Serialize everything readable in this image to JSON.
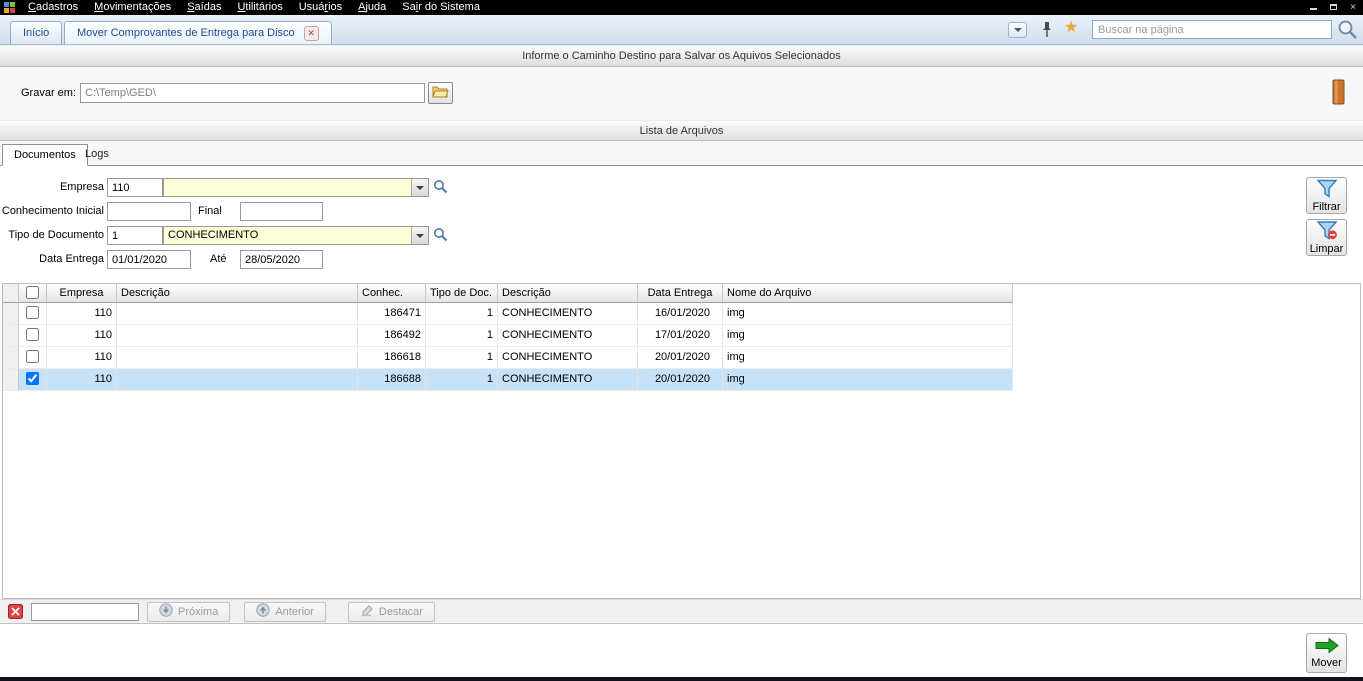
{
  "menu": {
    "items": [
      {
        "label": "Cadastros",
        "u": 0
      },
      {
        "label": "Movimentações",
        "u": 0
      },
      {
        "label": "Saídas",
        "u": 0
      },
      {
        "label": "Utilitários",
        "u": 0
      },
      {
        "label": "Usuários",
        "u": 4
      },
      {
        "label": "Ajuda",
        "u": 0
      },
      {
        "label": "Sair do Sistema",
        "u": 2
      }
    ]
  },
  "tabs": {
    "inicio": "Início",
    "active": "Mover Comprovantes de Entrega para Disco"
  },
  "topbar": {
    "search_placeholder": "Buscar na página"
  },
  "headers": {
    "destination": "Informe o Caminho Destino para Salvar os Aquivos Selecionados",
    "lista": "Lista de Arquivos"
  },
  "path": {
    "label": "Gravar em:",
    "value": "C:\\Temp\\GED\\"
  },
  "doc_tabs": {
    "documentos": "Documentos",
    "logs": "Logs"
  },
  "filters": {
    "empresa_label": "Empresa",
    "empresa_code": "110",
    "empresa_name": "",
    "conhecimento_label": "Conhecimento Inicial",
    "conhecimento_inicial": "",
    "final_label": "Final",
    "conhecimento_final": "",
    "tipo_label": "Tipo de Documento",
    "tipo_code": "1",
    "tipo_name": "CONHECIMENTO",
    "data_label": "Data Entrega",
    "data_inicial": "01/01/2020",
    "ate_label": "Até",
    "data_final": "28/05/2020",
    "filtrar_label": "Filtrar",
    "limpar_label": "Limpar"
  },
  "grid": {
    "columns": [
      "Empresa",
      "Descrição",
      "Conhec.",
      "Tipo de Doc.",
      "Descrição",
      "Data Entrega",
      "Nome do Arquivo"
    ],
    "rows": [
      {
        "checked": false,
        "selected": false,
        "empresa": "110",
        "descricao": "",
        "conhec": "186471",
        "tipo": "1",
        "tipo_desc": "CONHECIMENTO",
        "data": "16/01/2020",
        "arquivo": "img"
      },
      {
        "checked": false,
        "selected": false,
        "empresa": "110",
        "descricao": "",
        "conhec": "186492",
        "tipo": "1",
        "tipo_desc": "CONHECIMENTO",
        "data": "17/01/2020",
        "arquivo": "img"
      },
      {
        "checked": false,
        "selected": false,
        "empresa": "110",
        "descricao": "",
        "conhec": "186618",
        "tipo": "1",
        "tipo_desc": "CONHECIMENTO",
        "data": "20/01/2020",
        "arquivo": "img"
      },
      {
        "checked": true,
        "selected": true,
        "empresa": "110",
        "descricao": "",
        "conhec": "186688",
        "tipo": "1",
        "tipo_desc": "CONHECIMENTO",
        "data": "20/01/2020",
        "arquivo": "img"
      }
    ]
  },
  "finder": {
    "proxima": "Próxima",
    "anterior": "Anterior",
    "destacar": "Destacar"
  },
  "actions": {
    "mover": "Mover"
  },
  "icons": {
    "filtrar": "funnel-blue-icon",
    "limpar": "funnel-minus-icon",
    "mover": "green-arrow-icon",
    "folder": "open-folder-icon",
    "combo_lookup": "magnifier-icon"
  },
  "colors": {
    "menubar": "#000000",
    "selection": "#c7e1f8",
    "combo_bg": "#fffcd6",
    "accent_blue": "#2d7fc1",
    "mover_green": "#1ea427",
    "star": "#f2a431"
  }
}
